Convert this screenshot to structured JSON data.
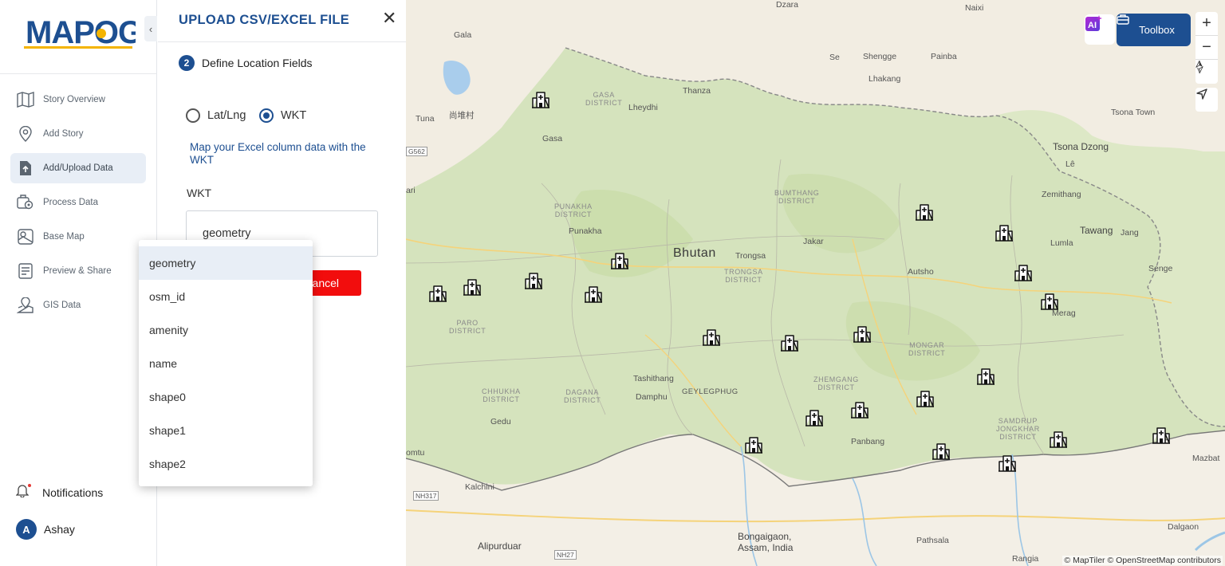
{
  "app": {
    "logo_text": "MAPOG"
  },
  "sidebar": {
    "items": [
      {
        "label": "Story Overview"
      },
      {
        "label": "Add Story"
      },
      {
        "label": "Add/Upload Data"
      },
      {
        "label": "Process Data"
      },
      {
        "label": "Base Map"
      },
      {
        "label": "Preview & Share"
      },
      {
        "label": "GIS Data"
      }
    ],
    "notifications_label": "Notifications",
    "user_initial": "A",
    "user_name": "Ashay"
  },
  "panel": {
    "title": "UPLOAD CSV/EXCEL FILE",
    "step_number": "2",
    "step_label": "Define Location Fields",
    "radio_latlng": "Lat/Lng",
    "radio_wkt": "WKT",
    "selected_mode": "WKT",
    "hint": "Map your Excel column data with the WKT",
    "wkt_label": "WKT",
    "wkt_value": "geometry",
    "cancel_label": "ancel"
  },
  "dropdown": {
    "options": [
      "geometry",
      "osm_id",
      "amenity",
      "name",
      "shape0",
      "shape1",
      "shape2"
    ],
    "highlighted": "geometry"
  },
  "map": {
    "country_label": "Bhutan",
    "toolbox_label": "Toolbox",
    "zoom_in": "+",
    "zoom_out": "−",
    "attribution": "© MapTiler © OpenStreetMap contributors",
    "places": {
      "dzara": "Dzara",
      "naixi": "Naixi",
      "gala": "Gala",
      "se": "Se",
      "shengge": "Shengge",
      "painba": "Painba",
      "lhakang": "Lhakang",
      "tuna": "Tuna",
      "shangdui": "尚堆村",
      "gasa_district": "GASA\nDISTRICT",
      "thanza": "Thanza",
      "lheydhi": "Lheydhi",
      "gasa": "Gasa",
      "tsona_town": "Tsona Town",
      "tsona_dzong": "Tsona Dzong",
      "le": "Lê",
      "g562": "G562",
      "ari": "ari",
      "bumthang": "BUMTHANG\nDISTRICT",
      "zemithang": "Zemithang",
      "punakha_district": "PUNAKHA\nDISTRICT",
      "punakha": "Punakha",
      "jakar": "Jakar",
      "tawang": "Tawang",
      "jang": "Jang",
      "lumla": "Lumla",
      "trongsa": "Trongsa",
      "trongsa_district": "TRONGSA\nDISTRICT",
      "autsho": "Autsho",
      "senge": "Senge",
      "paro_district": "PARO\nDISTRICT",
      "merag": "Merag",
      "mongar_district": "MONGAR\nDISTRICT",
      "tashithang": "Tashithang",
      "zhemgang_district": "ZHEMGANG\nDISTRICT",
      "damphu": "Damphu",
      "geylegphug": "GEYLEGPHUG",
      "chhukha_district": "CHHUKHA\nDISTRICT",
      "dagana_district": "DAGANA\nDISTRICT",
      "gedu": "Gedu",
      "samdrup": "SAMDRUP\nJONGKHAR\nDISTRICT",
      "omtu": "omtu",
      "panbang": "Panbang",
      "mazbat": "Mazbat",
      "kalchini": "Kalchini",
      "nh317": "NH317",
      "bongaigaon": "Bongaigaon,\nAssam, India",
      "pathsala": "Pathsala",
      "dalgaon": "Dalgaon",
      "alipurduar": "Alipurduar",
      "nh27": "NH27",
      "rangia": "Rangia"
    }
  }
}
